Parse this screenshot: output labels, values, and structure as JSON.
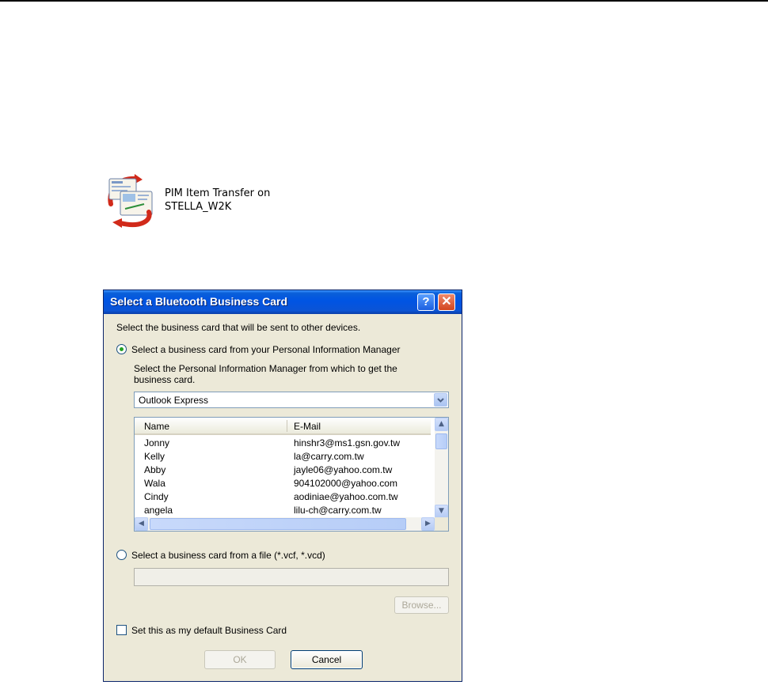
{
  "shortcut": {
    "label_line1": "PIM Item Transfer on",
    "label_line2": "STELLA_W2K",
    "icon": "business-card-transfer-icon"
  },
  "dialog": {
    "title": "Select a Bluetooth Business Card",
    "help_label": "?",
    "close_label": "✕",
    "intro": "Select the business card that will be sent to other devices.",
    "option_pim": "Select a business card from your Personal Information Manager",
    "pim_prompt_line1": "Select the Personal Information Manager from which to get the",
    "pim_prompt_line2": "business card.",
    "pim_selected": "Outlook Express",
    "columns": [
      "Name",
      "E-Mail"
    ],
    "contacts": [
      {
        "name": "Jonny",
        "email": "hinshr3@ms1.gsn.gov.tw"
      },
      {
        "name": "Kelly",
        "email": "la@carry.com.tw"
      },
      {
        "name": "Abby",
        "email": "jayle06@yahoo.com.tw"
      },
      {
        "name": "Wala",
        "email": "904102000@yahoo.com"
      },
      {
        "name": "Cindy",
        "email": "aodiniae@yahoo.com.tw"
      },
      {
        "name": "angela",
        "email": "lilu-ch@carry.com.tw"
      }
    ],
    "option_file": "Select a business card from a file (*.vcf, *.vcd)",
    "file_value": "",
    "browse_label": "Browse...",
    "default_checkbox": "Set this as my default Business Card",
    "ok_label": "OK",
    "cancel_label": "Cancel",
    "selected_option": "pim"
  },
  "colors": {
    "titlebar": "#0054e3",
    "dialog_bg": "#ece9d8",
    "radio_dot": "#21a121"
  }
}
